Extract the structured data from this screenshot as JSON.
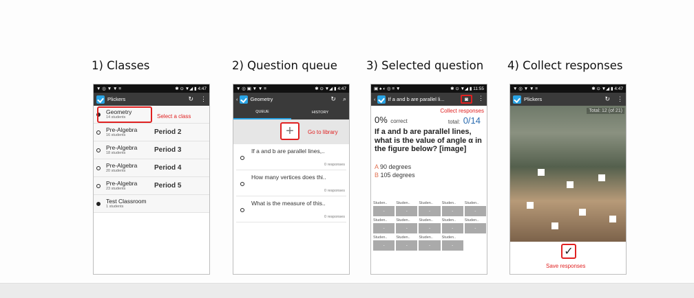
{
  "titles": [
    "1) Classes",
    "2) Question queue",
    "3) Selected question",
    "4) Collect responses"
  ],
  "p1": {
    "status_left": "▼ ◎ ▼ ▼ ≡",
    "status_right": "✱ ⊙ ▼◢ ▮ 4:47",
    "app_title": "Plickers",
    "classes": [
      {
        "name": "Geometry",
        "sub": "14 students",
        "period": ""
      },
      {
        "name": "Pre-Algebra",
        "sub": "16 students",
        "period": "Period 2"
      },
      {
        "name": "Pre-Algebra",
        "sub": "18 students",
        "period": "Period 3"
      },
      {
        "name": "Pre-Algebra",
        "sub": "20 students",
        "period": "Period 4"
      },
      {
        "name": "Pre-Algebra",
        "sub": "23 students",
        "period": "Period 5"
      },
      {
        "name": "Test Classroom",
        "sub": "1 students",
        "period": ""
      }
    ],
    "callout": "Select a class"
  },
  "p2": {
    "status_left": "▼ ◎ ▣ ▼ ▼ ≡",
    "status_right": "✱ ⊙ ▼◢ ▮ 4:47",
    "app_title": "Geometry",
    "tab_queue": "QUEUE",
    "tab_history": "HISTORY",
    "callout": "Go to library",
    "questions": [
      {
        "text": "If a and b are parallel lines,..",
        "responses": "0 responses"
      },
      {
        "text": "How many vertices does thi..",
        "responses": "0 responses"
      },
      {
        "text": "What is the measure of this..",
        "responses": "0 responses"
      }
    ]
  },
  "p3": {
    "status_left": "▣ ♠ ◐ ◎ ≡ ▼",
    "status_right": "✱ ⊙ ▼◢ ▮ 11:55",
    "app_title": "If a and b are parallel li...",
    "callout": "Collect responses",
    "percent": "0%",
    "percent_label": "correct",
    "total_label": "total:",
    "total_value": "0/14",
    "question": "If a and b are parallel lines, what is the value of angle α in the figure below? [image]",
    "answers": [
      {
        "letter": "A",
        "text": "90 degrees"
      },
      {
        "letter": "B",
        "text": "105 degrees"
      }
    ],
    "cell_label": "Studen..",
    "cell_value": "-"
  },
  "p4": {
    "status_left": "▼ ◎ ▼ ▼ ≡",
    "status_right": "✱ ⊙ ▼◢ ▮ 4:47",
    "app_title": "Plickers",
    "total_overlay": "Total: 12 (of 21)",
    "callout": "Save responses"
  },
  "colors": {
    "accent": "#29a3e4",
    "callout": "#e02020",
    "appbar": "#3a3a3a"
  }
}
